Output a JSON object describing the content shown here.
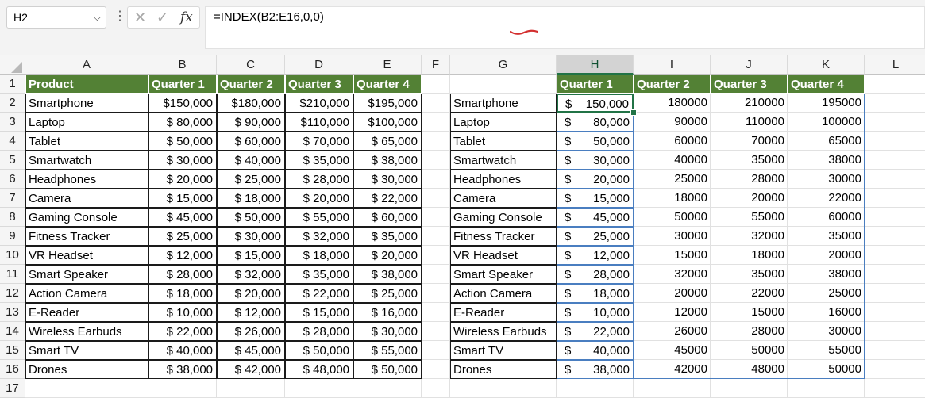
{
  "formula_bar": {
    "name_box": "H2",
    "name_box_chevron": "⌵",
    "more_icon": "⋮",
    "cancel_icon": "✕",
    "enter_icon": "✓",
    "fx_label": "fx",
    "formula": "=INDEX(B2:E16,0,0)"
  },
  "columns": [
    {
      "label": "",
      "width": 0
    },
    {
      "label": "A"
    },
    {
      "label": "B"
    },
    {
      "label": "C"
    },
    {
      "label": "D"
    },
    {
      "label": "E"
    },
    {
      "label": "F"
    },
    {
      "label": "G"
    },
    {
      "label": "H"
    },
    {
      "label": "I"
    },
    {
      "label": "J"
    },
    {
      "label": "K"
    },
    {
      "label": "L"
    }
  ],
  "rows": [
    "1",
    "2",
    "3",
    "4",
    "5",
    "6",
    "7",
    "8",
    "9",
    "10",
    "11",
    "12",
    "13",
    "14",
    "15",
    "16",
    "17"
  ],
  "source_table": {
    "headers": [
      "Product",
      "Quarter 1",
      "Quarter 2",
      "Quarter 3",
      "Quarter 4"
    ],
    "rows": [
      [
        "Smartphone",
        "$150,000",
        "$180,000",
        "$210,000",
        "$195,000"
      ],
      [
        "Laptop",
        "$ 80,000",
        "$ 90,000",
        "$110,000",
        "$100,000"
      ],
      [
        "Tablet",
        "$ 50,000",
        "$ 60,000",
        "$ 70,000",
        "$ 65,000"
      ],
      [
        "Smartwatch",
        "$ 30,000",
        "$ 40,000",
        "$ 35,000",
        "$ 38,000"
      ],
      [
        "Headphones",
        "$ 20,000",
        "$ 25,000",
        "$ 28,000",
        "$ 30,000"
      ],
      [
        "Camera",
        "$ 15,000",
        "$ 18,000",
        "$ 20,000",
        "$ 22,000"
      ],
      [
        "Gaming Console",
        "$ 45,000",
        "$ 50,000",
        "$ 55,000",
        "$ 60,000"
      ],
      [
        "Fitness Tracker",
        "$ 25,000",
        "$ 30,000",
        "$ 32,000",
        "$ 35,000"
      ],
      [
        "VR Headset",
        "$ 12,000",
        "$ 15,000",
        "$ 18,000",
        "$ 20,000"
      ],
      [
        "Smart Speaker",
        "$ 28,000",
        "$ 32,000",
        "$ 35,000",
        "$ 38,000"
      ],
      [
        "Action Camera",
        "$ 18,000",
        "$ 20,000",
        "$ 22,000",
        "$ 25,000"
      ],
      [
        "E-Reader",
        "$ 10,000",
        "$ 12,000",
        "$ 15,000",
        "$ 16,000"
      ],
      [
        "Wireless Earbuds",
        "$ 22,000",
        "$ 26,000",
        "$ 28,000",
        "$ 30,000"
      ],
      [
        "Smart TV",
        "$ 40,000",
        "$ 45,000",
        "$ 50,000",
        "$ 55,000"
      ],
      [
        "Drones",
        "$ 38,000",
        "$ 42,000",
        "$ 48,000",
        "$ 50,000"
      ]
    ]
  },
  "result_table": {
    "headers": [
      "Quarter 1",
      "Quarter 2",
      "Quarter 3",
      "Quarter 4"
    ],
    "products": [
      "Smartphone",
      "Laptop",
      "Tablet",
      "Smartwatch",
      "Headphones",
      "Camera",
      "Gaming Console",
      "Fitness Tracker",
      "VR Headset",
      "Smart Speaker",
      "Action Camera",
      "E-Reader",
      "Wireless Earbuds",
      "Smart TV",
      "Drones"
    ],
    "currency_symbol": "$",
    "q1": [
      "150,000",
      "80,000",
      "50,000",
      "30,000",
      "20,000",
      "15,000",
      "45,000",
      "25,000",
      "12,000",
      "28,000",
      "18,000",
      "10,000",
      "22,000",
      "40,000",
      "38,000"
    ],
    "rows": [
      [
        "180000",
        "210000",
        "195000"
      ],
      [
        "90000",
        "110000",
        "100000"
      ],
      [
        "60000",
        "70000",
        "65000"
      ],
      [
        "40000",
        "35000",
        "38000"
      ],
      [
        "25000",
        "28000",
        "30000"
      ],
      [
        "18000",
        "20000",
        "22000"
      ],
      [
        "50000",
        "55000",
        "60000"
      ],
      [
        "30000",
        "32000",
        "35000"
      ],
      [
        "15000",
        "18000",
        "20000"
      ],
      [
        "32000",
        "35000",
        "38000"
      ],
      [
        "20000",
        "22000",
        "25000"
      ],
      [
        "12000",
        "15000",
        "16000"
      ],
      [
        "26000",
        "28000",
        "30000"
      ],
      [
        "45000",
        "50000",
        "55000"
      ],
      [
        "42000",
        "48000",
        "50000"
      ]
    ]
  },
  "colors": {
    "header_fill": "#538135",
    "selection": "#217346",
    "spill_border": "#4a7ec0"
  }
}
